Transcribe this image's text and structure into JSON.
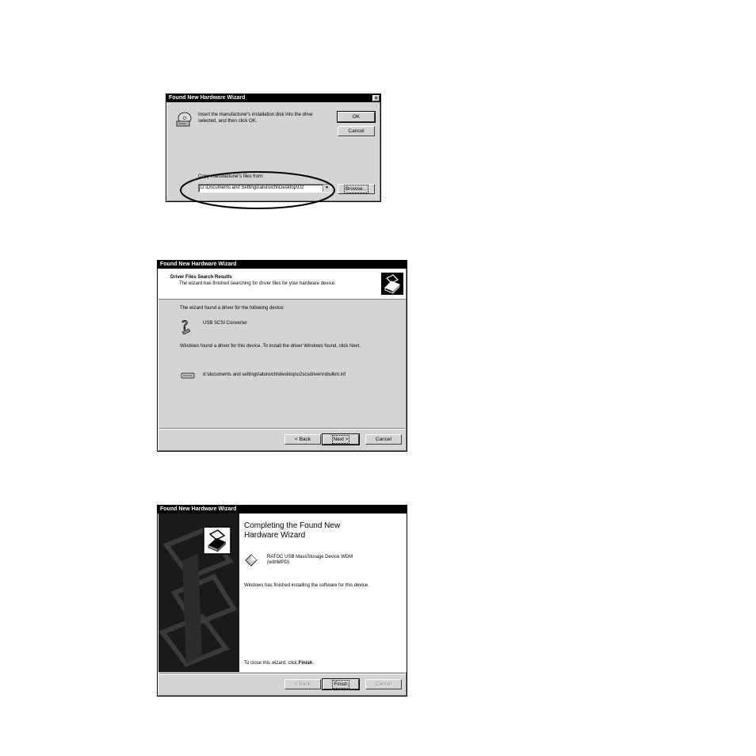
{
  "dialog1": {
    "title": "Found New Hardware Wizard",
    "close": "×",
    "message_line1": "Insert the manufacturer's installation disk into the drive",
    "message_line2": "selected, and then click OK.",
    "ok_label": "OK",
    "cancel_label": "Cancel",
    "copy_label": "Copy manufacturer's files from:",
    "path_value": "D:\\Documents and Settings\\aturuichi\\Desktop\\U2",
    "browse_label": "Browse..."
  },
  "dialog2": {
    "title": "Found New Hardware Wizard",
    "header_title": "Driver Files Search Results",
    "header_subtitle": "The wizard has finished searching for driver files for your hardware device.",
    "found_text": "The wizard found a driver for the following device:",
    "device_name": "USB SCSI Converter",
    "info_text": "Windows found a driver for this device. To install the driver Windows found, click Next.",
    "driver_path": "d:\\documents and settings\\aturuichi\\desktop\\u2scsdriver\\rsbulkm.inf",
    "back_label": "< Back",
    "next_label": "Next >",
    "cancel_label": "Cancel"
  },
  "dialog3": {
    "title": "Found New Hardware Wizard",
    "heading_line1": "Completing the Found New",
    "heading_line2": "Hardware Wizard",
    "device_line1": "RATOC USB MassStorage Device WDM",
    "device_line2": "(withMPD)",
    "finished_text": "Windows has finished installing the software for this device.",
    "close_text_prefix": "To close this wizard, click ",
    "close_text_bold": "Finish",
    "close_text_suffix": ".",
    "back_label": "< Back",
    "finish_label": "Finish",
    "cancel_label": "Cancel"
  }
}
